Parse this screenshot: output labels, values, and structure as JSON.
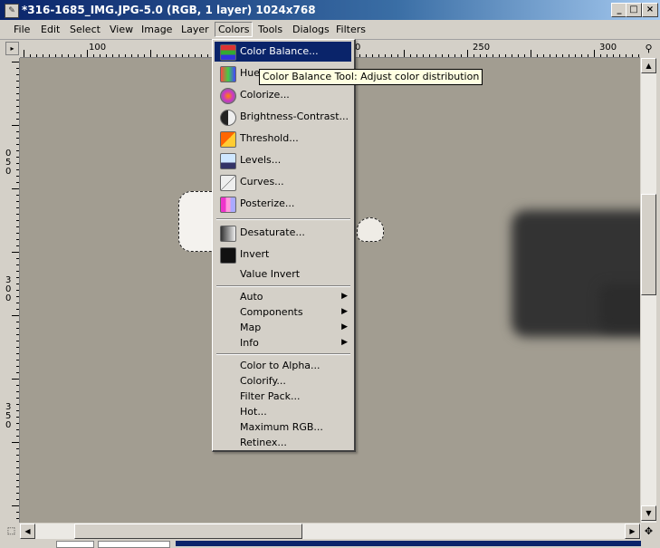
{
  "window": {
    "title": "*316-1685_IMG.JPG-5.0 (RGB, 1 layer) 1024x768",
    "app_icon": "gimp-icon"
  },
  "menubar": [
    "File",
    "Edit",
    "Select",
    "View",
    "Image",
    "Layer",
    "Colors",
    "Tools",
    "Dialogs",
    "Filters"
  ],
  "ruler": {
    "h_labels": [
      "100",
      "0",
      "250",
      "300"
    ],
    "v_labels": [
      "0",
      "5",
      "0",
      "3",
      "0",
      "0",
      "3",
      "5",
      "0"
    ]
  },
  "colors_menu": {
    "items": [
      {
        "label": "Color Balance...",
        "icon": "color-balance-icon",
        "selected": true
      },
      {
        "label": "Hue-",
        "icon": "hue-saturation-icon"
      },
      {
        "label": "Colorize...",
        "icon": "colorize-icon"
      },
      {
        "label": "Brightness-Contrast...",
        "icon": "brightness-contrast-icon"
      },
      {
        "label": "Threshold...",
        "icon": "threshold-icon"
      },
      {
        "label": "Levels...",
        "icon": "levels-icon"
      },
      {
        "label": "Curves...",
        "icon": "curves-icon"
      },
      {
        "label": "Posterize...",
        "icon": "posterize-icon"
      },
      {
        "label": "Desaturate...",
        "icon": "desaturate-icon"
      },
      {
        "label": "Invert",
        "icon": "invert-icon"
      },
      {
        "label": "Value Invert",
        "icon": ""
      },
      {
        "label": "Auto",
        "submenu": true
      },
      {
        "label": "Components",
        "submenu": true
      },
      {
        "label": "Map",
        "submenu": true
      },
      {
        "label": "Info",
        "submenu": true
      },
      {
        "label": "Color to Alpha..."
      },
      {
        "label": "Colorify..."
      },
      {
        "label": "Filter Pack..."
      },
      {
        "label": "Hot..."
      },
      {
        "label": "Maximum RGB..."
      },
      {
        "label": "Retinex..."
      }
    ]
  },
  "tooltip": "Color Balance Tool: Adjust color distribution",
  "colors": {
    "selection": "#0a246a",
    "canvas": "#a29d91",
    "titlebar": "#0a246a",
    "tooltip_bg": "#ffffe1"
  }
}
